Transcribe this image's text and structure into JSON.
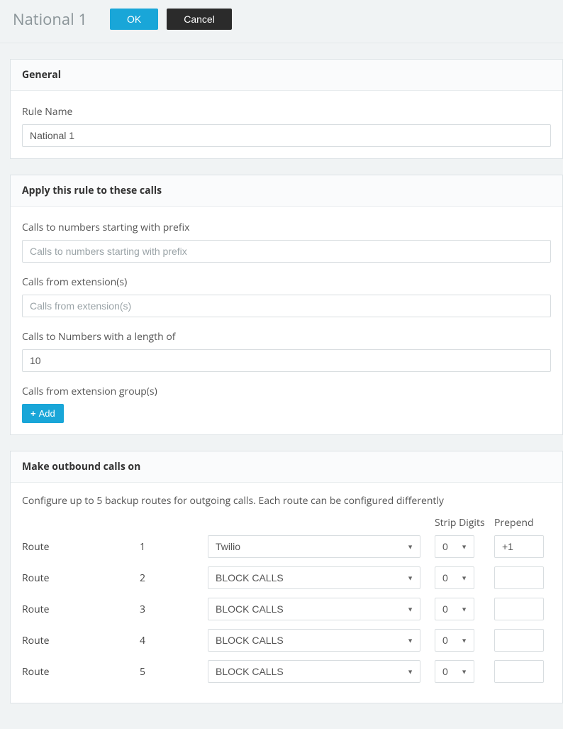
{
  "header": {
    "title": "National 1",
    "ok_label": "OK",
    "cancel_label": "Cancel"
  },
  "panels": {
    "general": {
      "title": "General",
      "rule_name_label": "Rule Name",
      "rule_name_value": "National 1"
    },
    "apply": {
      "title": "Apply this rule to these calls",
      "prefix_label": "Calls to numbers starting with prefix",
      "prefix_placeholder": "Calls to numbers starting with prefix",
      "prefix_value": "",
      "ext_label": "Calls from extension(s)",
      "ext_placeholder": "Calls from extension(s)",
      "ext_value": "",
      "length_label": "Calls to Numbers with a length of",
      "length_value": "10",
      "groups_label": "Calls from extension group(s)",
      "add_label": "Add"
    },
    "outbound": {
      "title": "Make outbound calls on",
      "helper": "Configure up to 5 backup routes for outgoing calls. Each route can be configured differently",
      "col_strip": "Strip Digits",
      "col_prepend": "Prepend",
      "route_label": "Route",
      "routes": [
        {
          "num": "1",
          "provider": "Twilio",
          "strip": "0",
          "prepend": "+1"
        },
        {
          "num": "2",
          "provider": "BLOCK CALLS",
          "strip": "0",
          "prepend": ""
        },
        {
          "num": "3",
          "provider": "BLOCK CALLS",
          "strip": "0",
          "prepend": ""
        },
        {
          "num": "4",
          "provider": "BLOCK CALLS",
          "strip": "0",
          "prepend": ""
        },
        {
          "num": "5",
          "provider": "BLOCK CALLS",
          "strip": "0",
          "prepend": ""
        }
      ]
    }
  }
}
